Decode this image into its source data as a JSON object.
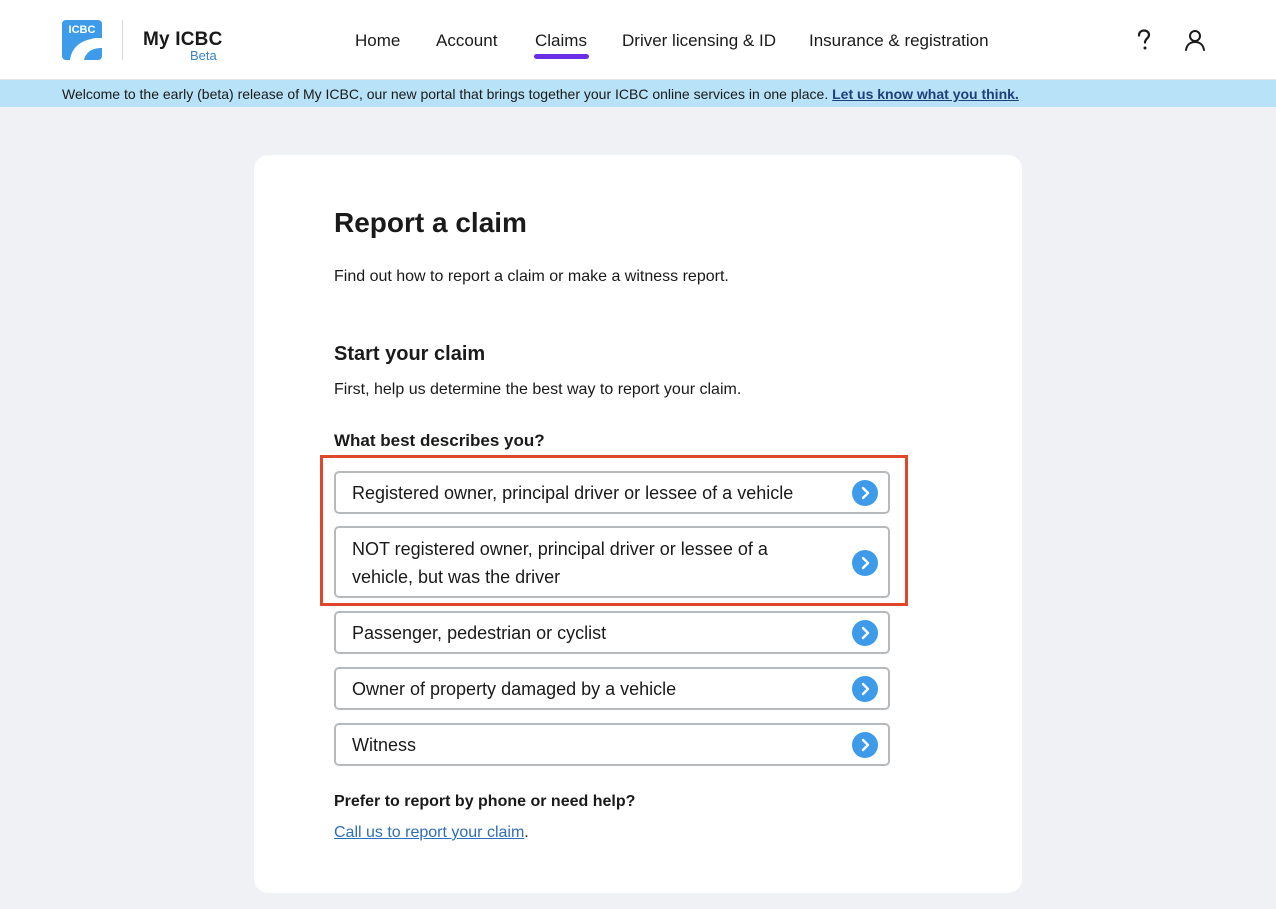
{
  "header": {
    "logo_text": "ICBC",
    "brand_title": "My ICBC",
    "brand_badge": "Beta",
    "nav": [
      {
        "label": "Home"
      },
      {
        "label": "Account"
      },
      {
        "label": "Claims",
        "active": true
      },
      {
        "label": "Driver licensing & ID"
      },
      {
        "label": "Insurance & registration"
      }
    ],
    "help_icon": "question-mark-icon",
    "user_icon": "user-profile-icon"
  },
  "banner": {
    "text": "Welcome to the early (beta) release of My ICBC, our new portal that brings together your ICBC online services in one place.",
    "link": "Let us know what you think."
  },
  "main": {
    "title": "Report a claim",
    "subtitle": "Find out how to report a claim or make a witness report.",
    "section_title": "Start your claim",
    "section_desc": "First, help us determine the best way to report your claim.",
    "question": "What best describes you?",
    "options": [
      {
        "label": "Registered owner, principal driver or lessee of a vehicle"
      },
      {
        "label": "NOT registered owner, principal driver or lessee of a vehicle, but was the driver"
      },
      {
        "label": "Passenger, pedestrian or cyclist"
      },
      {
        "label": "Owner of property damaged by a vehicle"
      },
      {
        "label": "Witness"
      }
    ],
    "help_heading": "Prefer to report by phone or need help?",
    "help_link": "Call us to report your claim",
    "help_suffix": "."
  },
  "colors": {
    "accent": "#6b2ee8",
    "banner_bg": "#b7e2f7",
    "arrow": "#3d9be9",
    "highlight": "#e0462a",
    "link": "#2f6fb9"
  }
}
